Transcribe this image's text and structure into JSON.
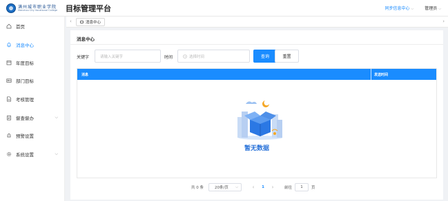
{
  "header": {
    "school_name": "满州城市职业学院",
    "school_en": "Manzhou City Vocational College",
    "app_title": "目标管理平台",
    "notify_label": "同步信息中心",
    "user_label": "管理员"
  },
  "sidebar": {
    "items": [
      {
        "label": "首页",
        "icon": "home-icon"
      },
      {
        "label": "消息中心",
        "icon": "bell-icon"
      },
      {
        "label": "年度目标",
        "icon": "calendar-icon"
      },
      {
        "label": "部门目标",
        "icon": "id-card-icon"
      },
      {
        "label": "考核管理",
        "icon": "document-icon"
      },
      {
        "label": "督查督办",
        "icon": "clipboard-icon"
      },
      {
        "label": "预警设置",
        "icon": "warning-bell-icon"
      },
      {
        "label": "系统设置",
        "icon": "gear-icon"
      }
    ],
    "active_index": 1
  },
  "tabs": {
    "items": [
      {
        "label": "消息中心"
      }
    ]
  },
  "main": {
    "title": "消息中心",
    "keyword_label": "关键字",
    "keyword_placeholder": "请输入关键字",
    "time_label": "时间",
    "time_placeholder": "选择时间",
    "search_button": "查询",
    "reset_button": "重置",
    "table": {
      "columns": [
        "消息",
        "发送时间"
      ],
      "rows": [],
      "empty_text": "暂无数据"
    }
  },
  "pagination": {
    "total_text": "共 0 条",
    "page_size": "20条/页",
    "current_page": "1",
    "goto_label": "前往",
    "goto_value": "1",
    "page_suffix": "页"
  },
  "colors": {
    "accent": "#1a8cff",
    "empty_text": "#2a73d9"
  }
}
